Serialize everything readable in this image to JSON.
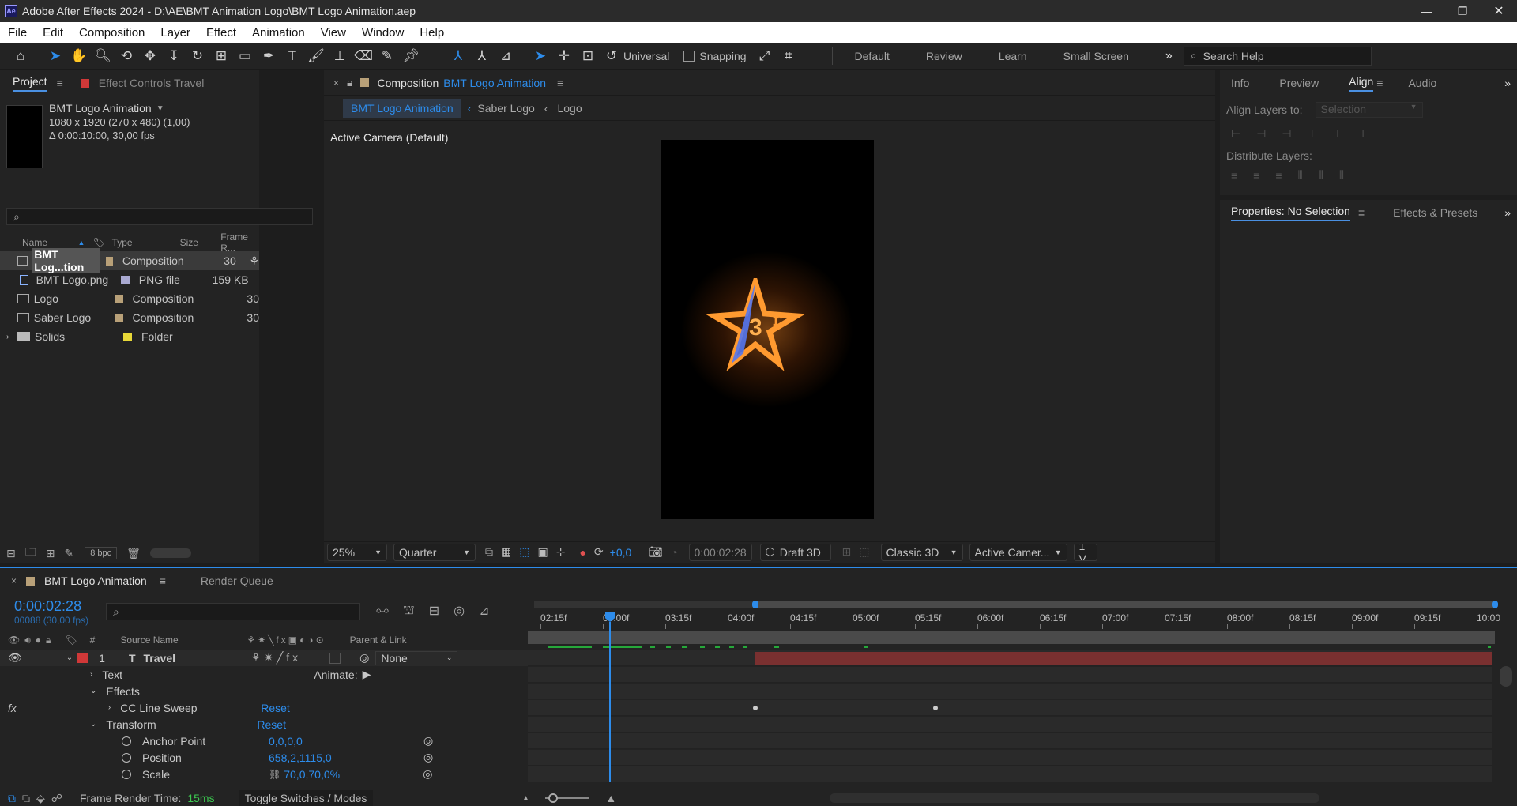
{
  "window": {
    "title": "Adobe After Effects 2024 - D:\\AE\\BMT Animation Logo\\BMT Logo Animation.aep",
    "app_icon": "Ae"
  },
  "menu": [
    "File",
    "Edit",
    "Composition",
    "Layer",
    "Effect",
    "Animation",
    "View",
    "Window",
    "Help"
  ],
  "toolbar": {
    "universal": "Universal",
    "snapping": "Snapping",
    "workspaces": [
      "Default",
      "Review",
      "Learn",
      "Small Screen"
    ],
    "search_placeholder": "Search Help"
  },
  "project": {
    "tab_project": "Project",
    "tab_effect": "Effect Controls Travel",
    "comp_name": "BMT Logo Animation",
    "comp_dims": "1080 x 1920  (270 x 480) (1,00)",
    "comp_duration": "Δ 0:00:10:00, 30,00 fps",
    "columns": [
      "Name",
      "Type",
      "Size",
      "Frame R..."
    ],
    "items": [
      {
        "name": "BMT Log...tion",
        "type": "Composition",
        "size": "",
        "fps": "30",
        "chip": "#b8a078"
      },
      {
        "name": "BMT Logo.png",
        "type": "PNG file",
        "size": "159 KB",
        "fps": "",
        "chip": "#a8a8d0"
      },
      {
        "name": "Logo",
        "type": "Composition",
        "size": "",
        "fps": "30",
        "chip": "#b8a078"
      },
      {
        "name": "Saber Logo",
        "type": "Composition",
        "size": "",
        "fps": "30",
        "chip": "#b8a078"
      },
      {
        "name": "Solids",
        "type": "Folder",
        "size": "",
        "fps": "",
        "chip": "#e8d838"
      }
    ],
    "bpc": "8 bpc"
  },
  "comp": {
    "tab_prefix": "Composition",
    "tab_name": "BMT Logo Animation",
    "crumbs": [
      "BMT Logo Animation",
      "Saber Logo",
      "Logo"
    ],
    "camera": "Active Camera (Default)",
    "zoom": "25%",
    "resolution": "Quarter",
    "exposure": "+0,0",
    "timecode": "0:00:02:28",
    "draft": "Draft 3D",
    "renderer": "Classic 3D",
    "view": "Active Camer...",
    "views": "1 V"
  },
  "right": {
    "tabs": [
      "Info",
      "Preview",
      "Align",
      "Audio"
    ],
    "align_to_label": "Align Layers to:",
    "align_to_value": "Selection",
    "distribute": "Distribute Layers:",
    "props_tab": "Properties: No Selection",
    "fx_tab": "Effects & Presets"
  },
  "timeline": {
    "tab": "BMT Logo Animation",
    "render_queue": "Render Queue",
    "timecode": "0:00:02:28",
    "frames": "00088 (30,00 fps)",
    "ruler": [
      "02:15f",
      "03:00f",
      "03:15f",
      "04:00f",
      "04:15f",
      "05:00f",
      "05:15f",
      "06:00f",
      "06:15f",
      "07:00f",
      "07:15f",
      "08:00f",
      "08:15f",
      "09:00f",
      "09:15f",
      "10:00"
    ],
    "col_source": "Source Name",
    "col_parent": "Parent & Link",
    "col_num": "#",
    "layer": {
      "num": "1",
      "name": "Travel",
      "parent": "None"
    },
    "props": [
      {
        "label": "Text",
        "value": "",
        "extra": "Animate:"
      },
      {
        "label": "Effects",
        "value": ""
      },
      {
        "label": "CC Line Sweep",
        "value": "Reset"
      },
      {
        "label": "Transform",
        "value": "Reset"
      },
      {
        "label": "Anchor Point",
        "value": "0,0,0,0"
      },
      {
        "label": "Position",
        "value": "658,2,1115,0"
      },
      {
        "label": "Scale",
        "value": "70,0,70,0%"
      }
    ],
    "render_time_label": "Frame Render Time:",
    "render_time": "15ms",
    "toggle": "Toggle Switches / Modes"
  }
}
